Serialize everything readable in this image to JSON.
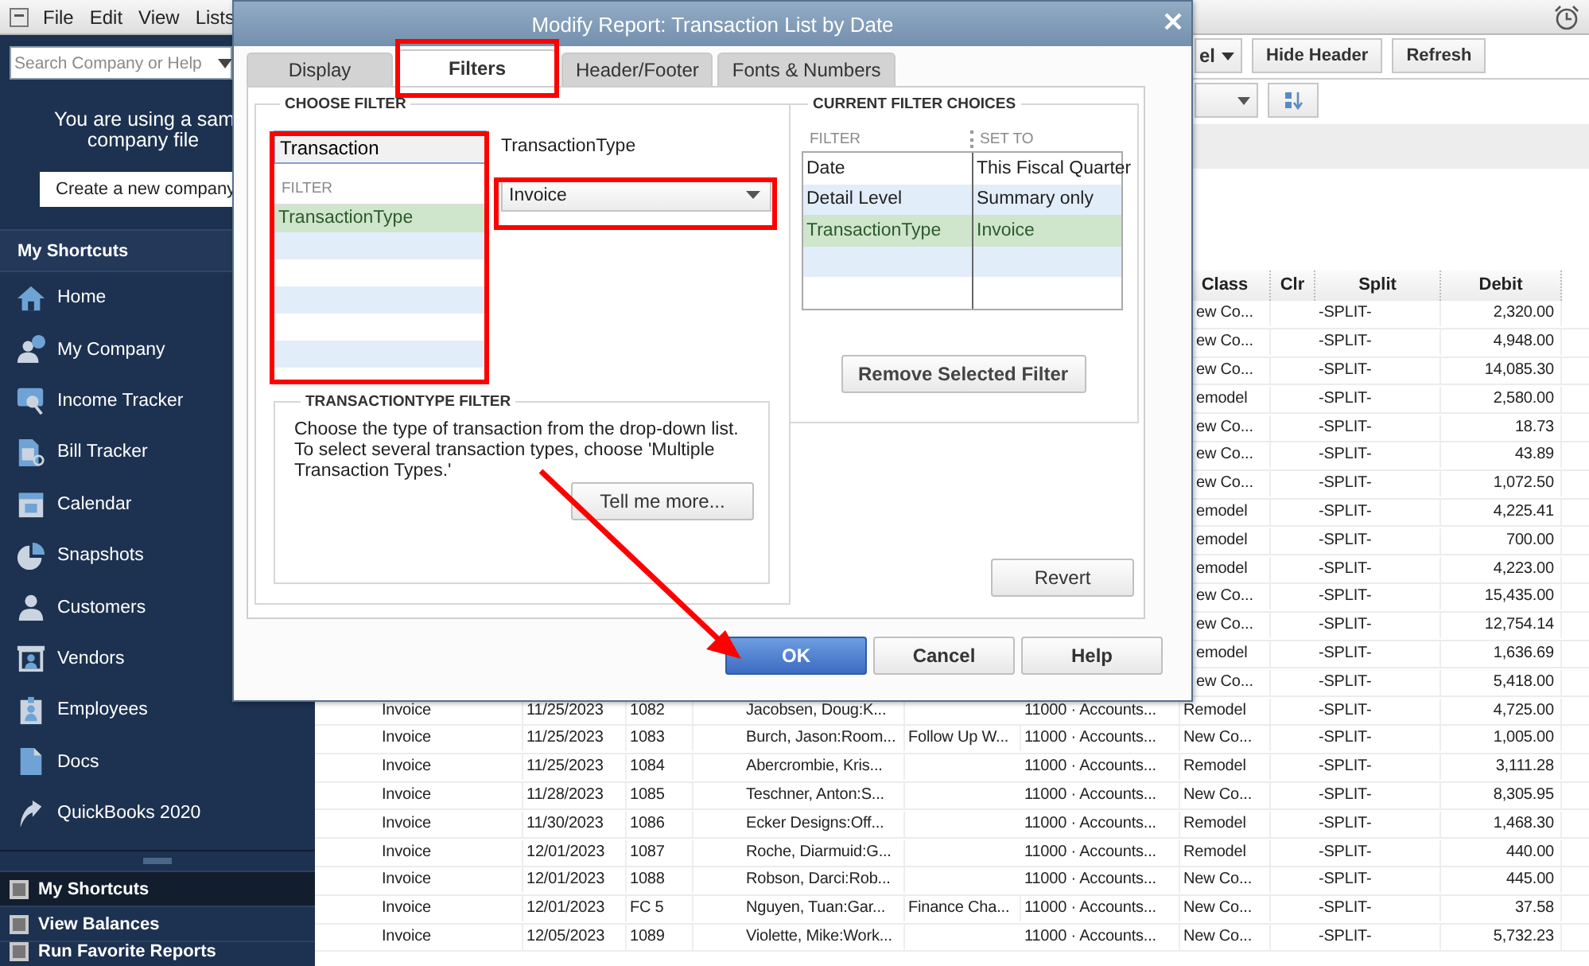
{
  "menu_bar": {
    "items": [
      "File",
      "Edit",
      "View",
      "Lists"
    ]
  },
  "sidebar": {
    "search": {
      "placeholder": "Search Company or Help"
    },
    "notice": "You are using a sam\ncompany file",
    "create_button": "Create a new company",
    "section_title": "My Shortcuts",
    "items": [
      "Home",
      "My Company",
      "Income Tracker",
      "Bill Tracker",
      "Calendar",
      "Snapshots",
      "Customers",
      "Vendors",
      "Employees",
      "Docs",
      "QuickBooks 2020"
    ],
    "bottom_items": [
      {
        "label": "My Shortcuts",
        "selected": true
      },
      {
        "label": "View Balances",
        "selected": false
      },
      {
        "label": "Run Favorite Reports",
        "selected": false
      }
    ]
  },
  "toolbar": {
    "dropdown_text": "el",
    "buttons": [
      "Hide Header",
      "Refresh"
    ]
  },
  "report": {
    "columns": [
      "Class",
      "Clr",
      "Split",
      "Debit"
    ],
    "rows": [
      {
        "class": "ew Co...",
        "split": "-SPLIT-",
        "debit": "2,320.00"
      },
      {
        "class": "ew Co...",
        "split": "-SPLIT-",
        "debit": "4,948.00"
      },
      {
        "class": "ew Co...",
        "split": "-SPLIT-",
        "debit": "14,085.30"
      },
      {
        "class": "emodel",
        "split": "-SPLIT-",
        "debit": "2,580.00"
      },
      {
        "class": "ew Co...",
        "split": "-SPLIT-",
        "debit": "18.73"
      },
      {
        "class": "ew Co...",
        "split": "-SPLIT-",
        "debit": "43.89"
      },
      {
        "class": "ew Co...",
        "split": "-SPLIT-",
        "debit": "1,072.50"
      },
      {
        "class": "emodel",
        "split": "-SPLIT-",
        "debit": "4,225.41"
      },
      {
        "class": "emodel",
        "split": "-SPLIT-",
        "debit": "700.00"
      },
      {
        "class": "emodel",
        "split": "-SPLIT-",
        "debit": "4,223.00"
      },
      {
        "class": "ew Co...",
        "split": "-SPLIT-",
        "debit": "15,435.00"
      },
      {
        "class": "ew Co...",
        "split": "-SPLIT-",
        "debit": "12,754.14"
      },
      {
        "class": "emodel",
        "split": "-SPLIT-",
        "debit": "1,636.69"
      },
      {
        "class": "ew Co...",
        "split": "-SPLIT-",
        "debit": "5,418.00"
      },
      {
        "column_1": "Invoice",
        "column_2": "11/25/2023",
        "column_3": "1082",
        "column_4": "Jacobsen, Doug:K...",
        "column_6": "11000 · Accounts...",
        "class": "Remodel",
        "split": "-SPLIT-",
        "debit": "4,725.00"
      },
      {
        "column_1": "Invoice",
        "column_2": "11/25/2023",
        "column_3": "1083",
        "column_4": "Burch, Jason:Room...",
        "column_5": "Follow Up W...",
        "column_6": "11000 · Accounts...",
        "class": "New Co...",
        "split": "-SPLIT-",
        "debit": "1,005.00"
      },
      {
        "column_1": "Invoice",
        "column_2": "11/25/2023",
        "column_3": "1084",
        "column_4": "Abercrombie, Kris...",
        "column_6": "11000 · Accounts...",
        "class": "Remodel",
        "split": "-SPLIT-",
        "debit": "3,111.28"
      },
      {
        "column_1": "Invoice",
        "column_2": "11/28/2023",
        "column_3": "1085",
        "column_4": "Teschner, Anton:S...",
        "column_6": "11000 · Accounts...",
        "class": "New Co...",
        "split": "-SPLIT-",
        "debit": "8,305.95"
      },
      {
        "column_1": "Invoice",
        "column_2": "11/30/2023",
        "column_3": "1086",
        "column_4": "Ecker Designs:Off...",
        "column_6": "11000 · Accounts...",
        "class": "Remodel",
        "split": "-SPLIT-",
        "debit": "1,468.30"
      },
      {
        "column_1": "Invoice",
        "column_2": "12/01/2023",
        "column_3": "1087",
        "column_4": "Roche, Diarmuid:G...",
        "column_6": "11000 · Accounts...",
        "class": "Remodel",
        "split": "-SPLIT-",
        "debit": "440.00"
      },
      {
        "column_1": "Invoice",
        "column_2": "12/01/2023",
        "column_3": "1088",
        "column_4": "Robson, Darci:Rob...",
        "column_6": "11000 · Accounts...",
        "class": "New Co...",
        "split": "-SPLIT-",
        "debit": "445.00"
      },
      {
        "column_1": "Invoice",
        "column_2": "12/01/2023",
        "column_3": "FC 5",
        "column_4": "Nguyen, Tuan:Gar...",
        "column_5": "Finance Cha...",
        "column_6": "11000 · Accounts...",
        "class": "New Co...",
        "split": "-SPLIT-",
        "debit": "37.58"
      },
      {
        "column_1": "Invoice",
        "column_2": "12/05/2023",
        "column_3": "1089",
        "column_4": "Violette, Mike:Work...",
        "column_6": "11000 · Accounts...",
        "class": "New Co...",
        "split": "-SPLIT-",
        "debit": "5,732.23"
      }
    ]
  },
  "dialog": {
    "title": "Modify Report: Transaction List by Date",
    "tabs": [
      {
        "label": "Display",
        "selected": false
      },
      {
        "label": "Filters",
        "selected": true
      },
      {
        "label": "Header/Footer",
        "selected": false
      },
      {
        "label": "Fonts & Numbers",
        "selected": false
      }
    ],
    "choose_filter": {
      "title": "CHOOSE FILTER",
      "search": {
        "value": "Transaction"
      },
      "list_header": "FILTER",
      "filters": [
        {
          "label": "TransactionType",
          "selected": true
        }
      ],
      "field_label": "TransactionType",
      "dropdown": {
        "value": "Invoice"
      }
    },
    "help_box": {
      "title": "TRANSACTIONTYPE FILTER",
      "text": "Choose the type of transaction from the drop-down list. To select several transaction types, choose 'Multiple Transaction Types.'",
      "button": "Tell me more..."
    },
    "current_filters": {
      "title": "CURRENT FILTER CHOICES",
      "columns": [
        "FILTER",
        "SET TO"
      ],
      "rows": [
        {
          "filter": "Date",
          "set_to": "This Fiscal Quarter",
          "selected": false
        },
        {
          "filter": "Detail Level",
          "set_to": "Summary only",
          "selected": false
        },
        {
          "filter": "TransactionType",
          "set_to": "Invoice",
          "selected": true
        }
      ],
      "button": "Remove Selected Filter"
    },
    "revert_button": "Revert",
    "buttons": [
      {
        "label": "OK",
        "kind": "default"
      },
      {
        "label": "Cancel",
        "kind": "normal"
      },
      {
        "label": "Help",
        "kind": "normal"
      }
    ]
  }
}
